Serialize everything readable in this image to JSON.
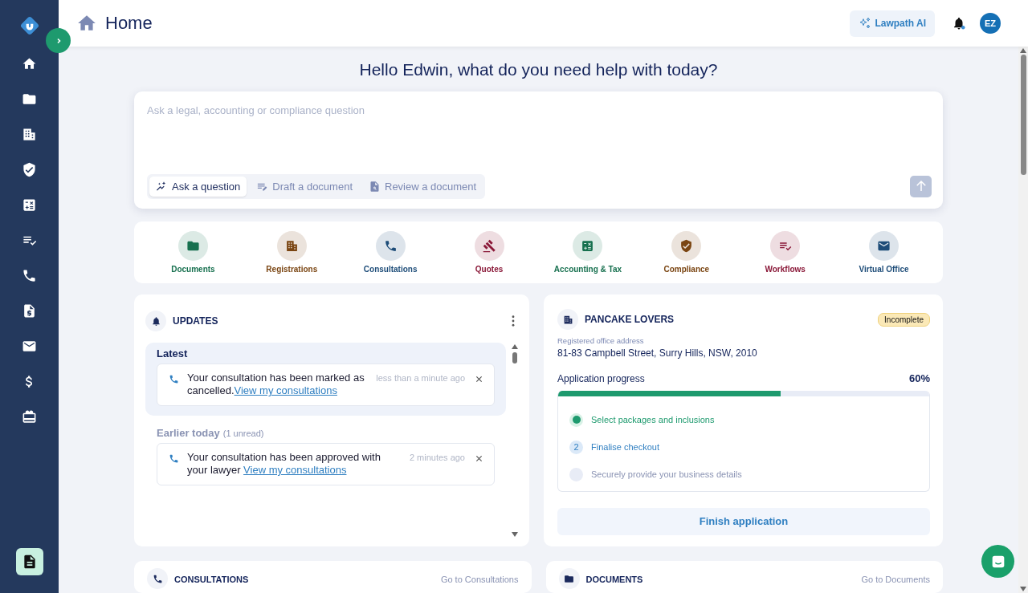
{
  "sidebar": {
    "items": [
      {
        "kind": "home"
      },
      {
        "kind": "folder"
      },
      {
        "kind": "building"
      },
      {
        "kind": "shield"
      },
      {
        "kind": "calculator"
      },
      {
        "kind": "checklist"
      },
      {
        "kind": "phone"
      },
      {
        "kind": "invoice"
      },
      {
        "kind": "mail"
      },
      {
        "kind": "dollar"
      },
      {
        "kind": "gift"
      }
    ]
  },
  "header": {
    "title": "Home",
    "ai_button": "Lawpath AI",
    "avatar": "EZ"
  },
  "greeting": "Hello Edwin, what do you need help with today?",
  "ask": {
    "placeholder": "Ask a legal, accounting or compliance question",
    "modes": [
      {
        "label": "Ask a question",
        "kind": "sparkle",
        "selected": true
      },
      {
        "label": "Draft a document",
        "kind": "draft",
        "selected": false
      },
      {
        "label": "Review a document",
        "kind": "review",
        "selected": false
      }
    ]
  },
  "categories": [
    {
      "label": "Documents",
      "kind": "folder",
      "color": "#17704f"
    },
    {
      "label": "Registrations",
      "kind": "building",
      "color": "#7a4512"
    },
    {
      "label": "Consultations",
      "kind": "phone",
      "color": "#1d4c78"
    },
    {
      "label": "Quotes",
      "kind": "gavel",
      "color": "#8a1838"
    },
    {
      "label": "Accounting & Tax",
      "kind": "calculator",
      "color": "#17704f"
    },
    {
      "label": "Compliance",
      "kind": "shield",
      "color": "#7a4512"
    },
    {
      "label": "Workflows",
      "kind": "checklist",
      "color": "#8a1838"
    },
    {
      "label": "Virtual Office",
      "kind": "mail",
      "color": "#1d4c78"
    }
  ],
  "updates": {
    "title": "UPDATES",
    "groups": [
      {
        "label": "Latest",
        "highlighted": true,
        "items": [
          {
            "text": "Your consultation has been marked as cancelled.",
            "link": "View my consultations",
            "time": "less than a minute ago"
          }
        ]
      },
      {
        "label": "Earlier today",
        "note": "(1 unread)",
        "highlighted": false,
        "items": [
          {
            "text": "Your consultation has been approved with your lawyer ",
            "link": "View my consultations",
            "time": "2 minutes ago"
          }
        ]
      }
    ]
  },
  "company": {
    "name": "PANCAKE LOVERS",
    "status": "Incomplete",
    "address_label": "Registered office address",
    "address": "81-83 Campbell Street, Surry Hills, NSW, 2010",
    "progress_label": "Application progress",
    "progress_text": "60%",
    "level": 0.6,
    "steps": [
      {
        "label": "Select packages and inclusions",
        "kind": "done"
      },
      {
        "label": "Finalise checkout",
        "kind": "current",
        "number": "2"
      },
      {
        "label": "Securely provide your business details",
        "kind": "todo"
      }
    ],
    "button": "Finish application"
  },
  "bottom_cards": [
    {
      "title": "CONSULTATIONS",
      "kind": "phone",
      "link": "Go to Consultations"
    },
    {
      "title": "DOCUMENTS",
      "kind": "folder",
      "link": "Go to Documents"
    }
  ]
}
